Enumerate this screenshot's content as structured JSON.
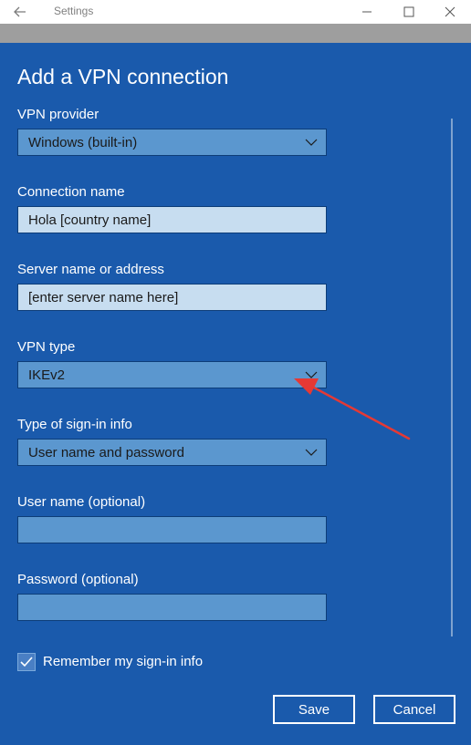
{
  "window": {
    "title": "Settings"
  },
  "page": {
    "heading": "Add a VPN connection"
  },
  "form": {
    "vpn_provider": {
      "label": "VPN provider",
      "value": "Windows (built-in)"
    },
    "connection_name": {
      "label": "Connection name",
      "value": "Hola [country name]"
    },
    "server_name": {
      "label": "Server name or address",
      "value": "[enter server name here]"
    },
    "vpn_type": {
      "label": "VPN type",
      "value": "IKEv2"
    },
    "sign_in_type": {
      "label": "Type of sign-in info",
      "value": "User name and password"
    },
    "user_name": {
      "label": "User name (optional)",
      "value": ""
    },
    "password": {
      "label": "Password (optional)",
      "value": ""
    },
    "remember": {
      "label": "Remember my sign-in info",
      "checked": true
    }
  },
  "buttons": {
    "save": "Save",
    "cancel": "Cancel"
  },
  "colors": {
    "panel": "#1a5aac",
    "field_dark": "#5b97cf",
    "field_light": "#c7ddf0",
    "annotation_arrow": "#e53935"
  }
}
